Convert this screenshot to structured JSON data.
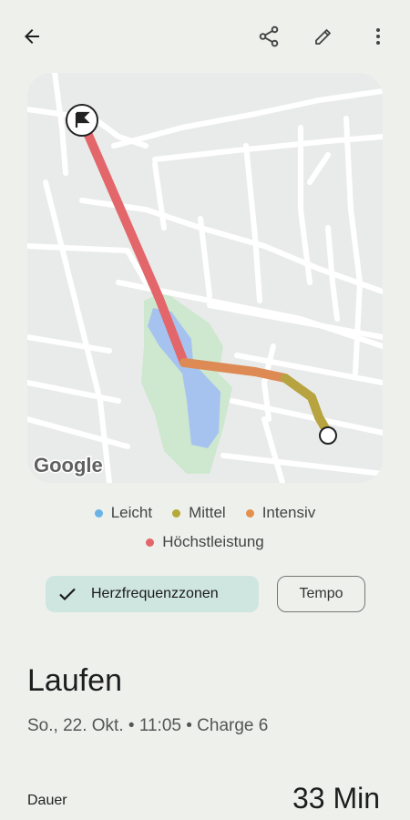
{
  "toolbar": {
    "back_icon": "arrow-left-icon",
    "share_icon": "share-icon",
    "edit_icon": "pencil-icon",
    "more_icon": "more-vert-icon"
  },
  "map": {
    "attribution": "Google",
    "start_icon": "flag-icon",
    "end_icon": "circle-marker-icon"
  },
  "legend": {
    "items": [
      {
        "label": "Leicht",
        "color": "#6ab3e6"
      },
      {
        "label": "Mittel",
        "color": "#b5a93a"
      },
      {
        "label": "Intensiv",
        "color": "#e2914c"
      },
      {
        "label": "Höchstleistung",
        "color": "#e3666b"
      }
    ]
  },
  "chips": {
    "selected_label": "Herzfrequenzzonen",
    "other_label": "Tempo"
  },
  "activity": {
    "title": "Laufen",
    "subtitle": "So., 22. Okt. • 11:05 • Charge 6"
  },
  "stats": {
    "duration_label": "Dauer",
    "duration_value": "33 Min"
  }
}
